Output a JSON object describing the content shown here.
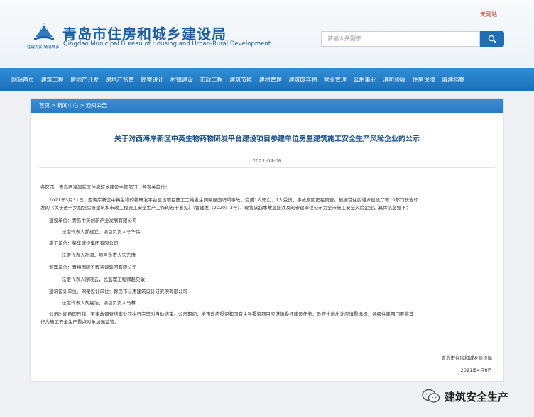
{
  "header": {
    "top_link": "天网站",
    "logo_slogan": "住建为民 情满城乡",
    "title": "青岛市住房和城乡建设局",
    "title_en": "Qingdao Municipal Bureau of Housing and Urban-Rural Development",
    "search_placeholder": "请输入关键字"
  },
  "nav": {
    "items": [
      "网站首页",
      "建筑工程",
      "房地产开发",
      "房地产监管",
      "勘察设计",
      "村镇建设",
      "市政工程",
      "建筑节能",
      "建材管理",
      "建筑废弃物",
      "物业管理",
      "公用事业",
      "消防验收",
      "住房保障",
      "城建档案"
    ]
  },
  "breadcrumb": [
    "首页",
    "新闻中心",
    "通知公告"
  ],
  "article": {
    "title": "关于对西海岸新区中英生物药物研发平台建设项目参建单位房屋建筑施工安全生产风险企业的公示",
    "date": "2021-04-06",
    "lines": [
      "各区市、青岛西海岸新区住房城乡建设主管部门、各有关单位：",
      "2021年3月31日，西海岸新区中英生物药物研发平台建设项目施工工地发生网架屋面坍塌事故，造成1人死亡、7人受伤，事故原因正在调查。根据首住房城乡建设厅等10部门联合印",
      "发的《关于进一步加强房屋建筑和市政工程施工安全生产工作的若干意见》（鲁建发〔2020〕3号），现将该起事故直接涉及的参建单位公示为全市施工安全风险企业，具体信息如下：",
      "建设单位：青岛中英创新产业发展有限公司",
      "法定代表人郝建立，项目负责人李华伟",
      "施工单位：荣华建设集团有限公司",
      "法定代表人孙渴，项目负责人宋东倩",
      "监理单位：青特国际工程咨询集团有限公司",
      "法定代表人徐晓云，总监理工程师赵贝敏",
      "建筑设计单位、网架设计单位：青岛市公用建筑设计研究院有限公司",
      "法定代表人胡晨浩，项目负责人马林",
      "公示时间自即日起，至事故调查结案处罚执行完毕时自动结束。公示期间，全市政府投资和国有主导投资项目应谨慎委托建设任务，政府土地出让应慎重选择；各级住建部门要将其",
      "作为施工安全生产重点对象加强监管。"
    ],
    "signature": "青岛市住房和城乡建设局",
    "signature_date": "2021年4月6日"
  },
  "watermark": {
    "text": "建筑安全生产",
    "icon": "wechat-icon"
  },
  "colors": {
    "brand_blue": "#1a5fa8",
    "nav_blue": "#1c6fb8",
    "title_blue": "#1a4e8a"
  }
}
